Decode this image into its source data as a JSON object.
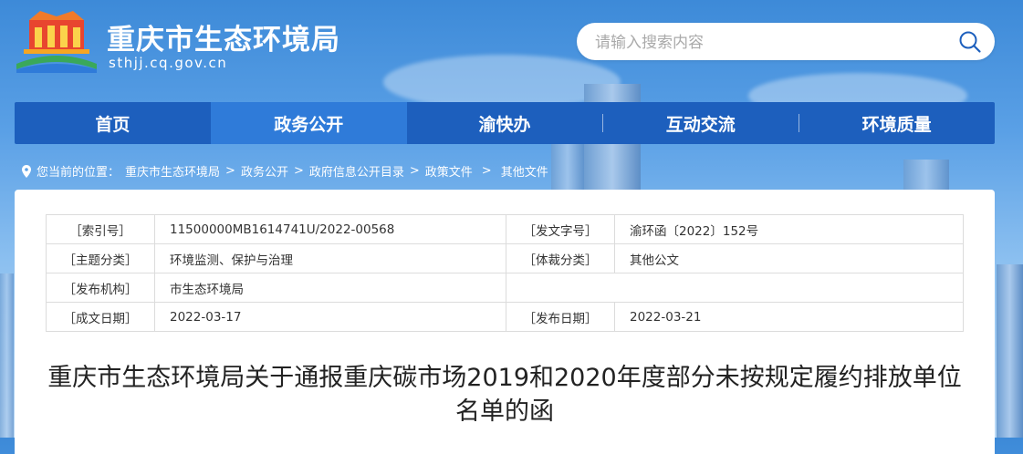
{
  "header": {
    "site_title": "重庆市生态环境局",
    "site_domain": "sthjj.cq.gov.cn"
  },
  "search": {
    "placeholder": "请输入搜索内容",
    "icon": "search-icon"
  },
  "nav": {
    "items": [
      {
        "label": "首页",
        "active": false
      },
      {
        "label": "政务公开",
        "active": true
      },
      {
        "label": "渝快办",
        "active": false
      },
      {
        "label": "互动交流",
        "active": false
      },
      {
        "label": "环境质量",
        "active": false
      }
    ]
  },
  "breadcrumb": {
    "prefix": "您当前的位置：",
    "items": [
      "重庆市生态环境局",
      "政务公开",
      "政府信息公开目录",
      "政策文件",
      "其他文件"
    ],
    "separator": ">"
  },
  "meta": {
    "index_no_label": "［索引号］",
    "index_no": "11500000MB1614741U/2022-00568",
    "doc_no_label": "［发文字号］",
    "doc_no": "渝环函〔2022〕152号",
    "topic_label": "［主题分类］",
    "topic": "环境监测、保护与治理",
    "genre_label": "［体裁分类］",
    "genre": "其他公文",
    "issuer_label": "［发布机构］",
    "issuer": "市生态环境局",
    "written_date_label": "［成文日期］",
    "written_date": "2022-03-17",
    "publish_date_label": "［发布日期］",
    "publish_date": "2022-03-21"
  },
  "document": {
    "title": "重庆市生态环境局关于通报重庆碳市场2019和2020年度部分未按规定履约排放单位名单的函"
  },
  "colors": {
    "nav_bg": "#1d5fbd",
    "nav_active": "#2f7bd9",
    "sky": "#3d8ad8"
  }
}
